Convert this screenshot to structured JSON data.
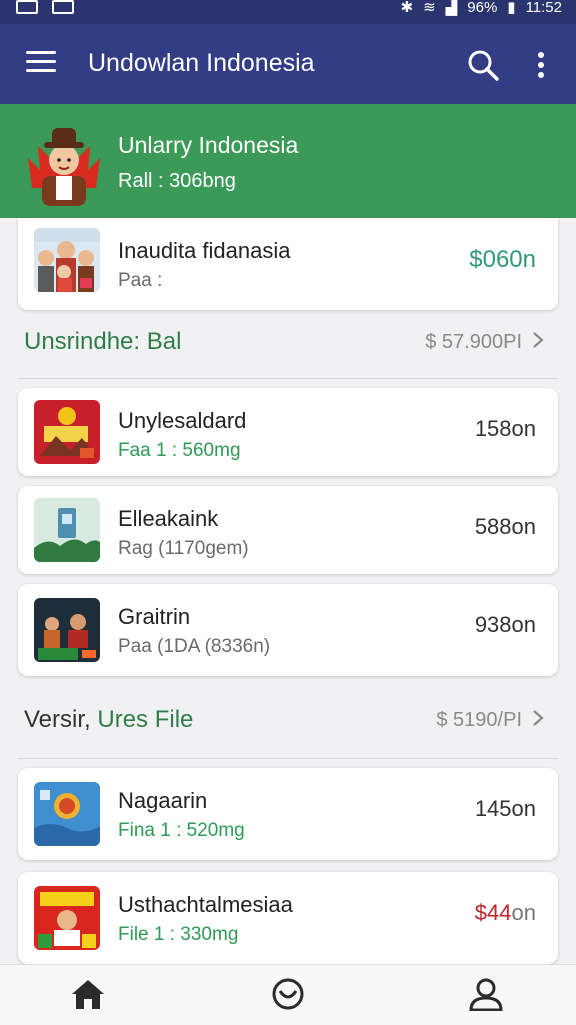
{
  "status_bar": {
    "battery": "96%",
    "time": "11:52"
  },
  "app_bar": {
    "title": "Undowlan Indonesia"
  },
  "banner": {
    "title": "Unlarry Indonesia",
    "subtitle": "Rall : 306bng"
  },
  "featured": {
    "name": "Inaudita fidanasia",
    "sub": "Paa :",
    "price": "$060n"
  },
  "sections": [
    {
      "title": "Unsrindhe: Bal",
      "meta": "$ 57.900PI",
      "items": [
        {
          "name": "Unylesaldard",
          "sub": "Faa 1 : 560mg",
          "price": "158on"
        },
        {
          "name": "Elleakaink",
          "sub": "Rag (1170gem)",
          "price": "588on"
        },
        {
          "name": "Graitrin",
          "sub": "Paa (1DA (8336n)",
          "price": "938on"
        }
      ]
    },
    {
      "title_dark": "Versir,",
      "title_green": "Ures File",
      "meta": "$ 5190/PI",
      "items": [
        {
          "name": "Nagaarin",
          "sub": "Fina 1 : 520mg",
          "price": "145on"
        },
        {
          "name": "Usthachtalmesiaa",
          "sub": "File 1 : 330mg",
          "price_red": "$44",
          "price_rest": "on"
        }
      ]
    }
  ],
  "colors": {
    "app_bar": "#323d86",
    "banner": "#3b9a57",
    "accent_green": "#2f9a55",
    "price_red": "#c0232a"
  },
  "icons": [
    "menu-icon",
    "search-icon",
    "more-vert-icon",
    "chevron-right-icon",
    "home-icon",
    "chat-icon",
    "profile-icon"
  ]
}
